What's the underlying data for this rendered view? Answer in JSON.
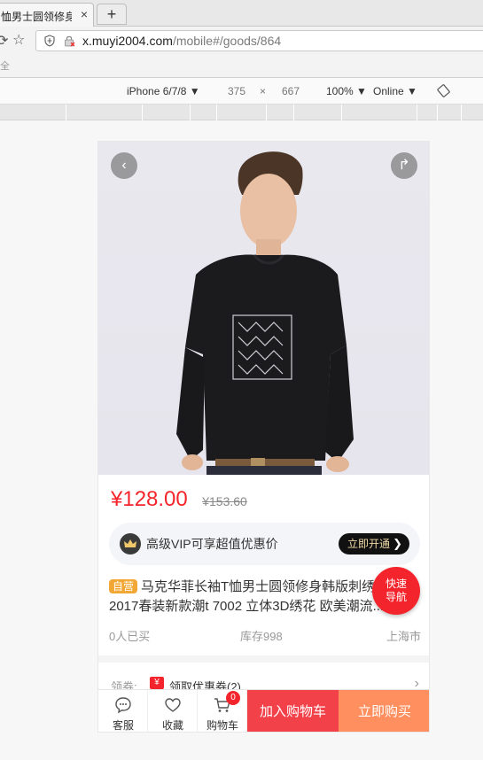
{
  "browser": {
    "tab_title": "恤男士圆领修身",
    "tab_close": "×",
    "new_tab": "+",
    "url_host": "x.muyi2004.com",
    "url_path": "/mobile#/goods/864",
    "addr_sub": "全"
  },
  "device_toolbar": {
    "device": "iPhone 6/7/8 ▼",
    "width": "375",
    "times": "×",
    "height": "667",
    "zoom": "100% ▼",
    "network": "Online ▼"
  },
  "product": {
    "back_icon": "‹",
    "share_icon": "↱",
    "price": "¥128.00",
    "old_price": "¥153.60",
    "vip_text": "高级VIP可享超值优惠价",
    "vip_button": "立即开通",
    "vip_chevron": "❯",
    "badge": "自营",
    "title_line1": "马克华菲长袖T恤男士圆领修身韩版刺绣",
    "title_line2": "2017春装新款潮t 7002 立体3D绣花 欧美潮流...",
    "fab_line1": "快速",
    "fab_line2": "导航",
    "buyers": "0人已买",
    "stock": "库存998",
    "location": "上海市",
    "coupon_label": "领券:",
    "coupon_tag": "¥",
    "coupon_text": "领取优惠券(2)",
    "coupon_arrow": "›"
  },
  "bottom_bar": {
    "service": "客服",
    "favorite": "收藏",
    "cart": "购物车",
    "cart_count": "0",
    "add_to_cart": "加入购物车",
    "buy_now": "立即购买"
  },
  "colors": {
    "price_red": "#f3242b",
    "add_cart": "#f3414a",
    "buy_now": "#ff8f5e",
    "self_badge": "#f2a735"
  },
  "icons": {
    "hero_back": "chevron-left-icon",
    "hero_share": "share-icon",
    "service": "chat-icon",
    "favorite": "heart-icon",
    "cart": "cart-icon",
    "crown": "crown-icon"
  }
}
